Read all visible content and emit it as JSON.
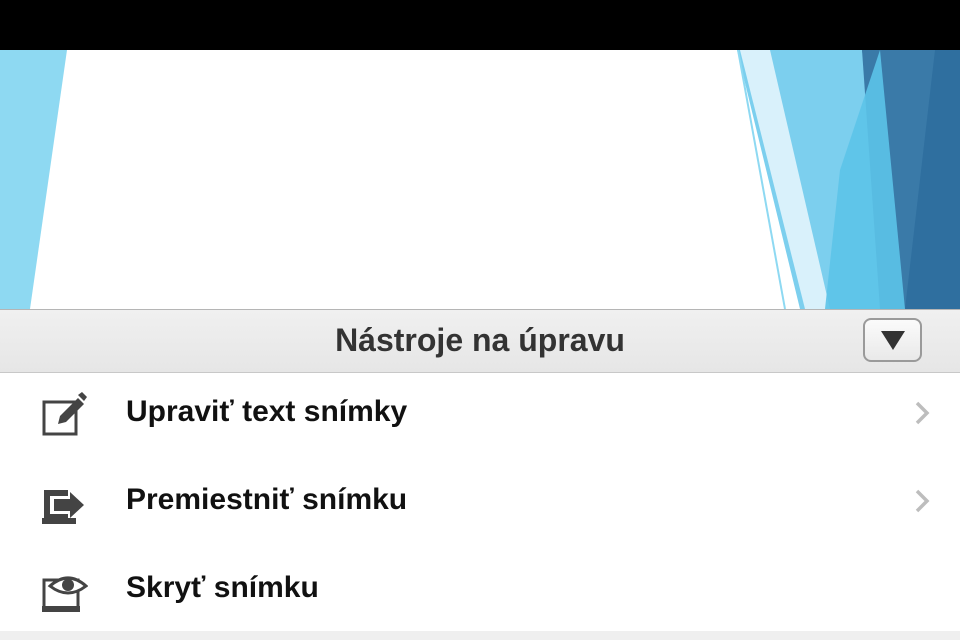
{
  "panel": {
    "title": "Nástroje na úpravu"
  },
  "tools": [
    {
      "label": "Upraviť text snímky",
      "icon": "edit-text-icon",
      "has_submenu": true
    },
    {
      "label": "Premiestniť snímku",
      "icon": "move-slide-icon",
      "has_submenu": true
    },
    {
      "label": "Skryť snímku",
      "icon": "hide-slide-icon",
      "has_submenu": false
    }
  ],
  "colors": {
    "slide_light_blue": "#8ed9f2",
    "slide_mid_blue": "#5fc5ea",
    "slide_dark_blue": "#2e6fa0",
    "header_text": "#333333",
    "item_text": "#111111"
  }
}
